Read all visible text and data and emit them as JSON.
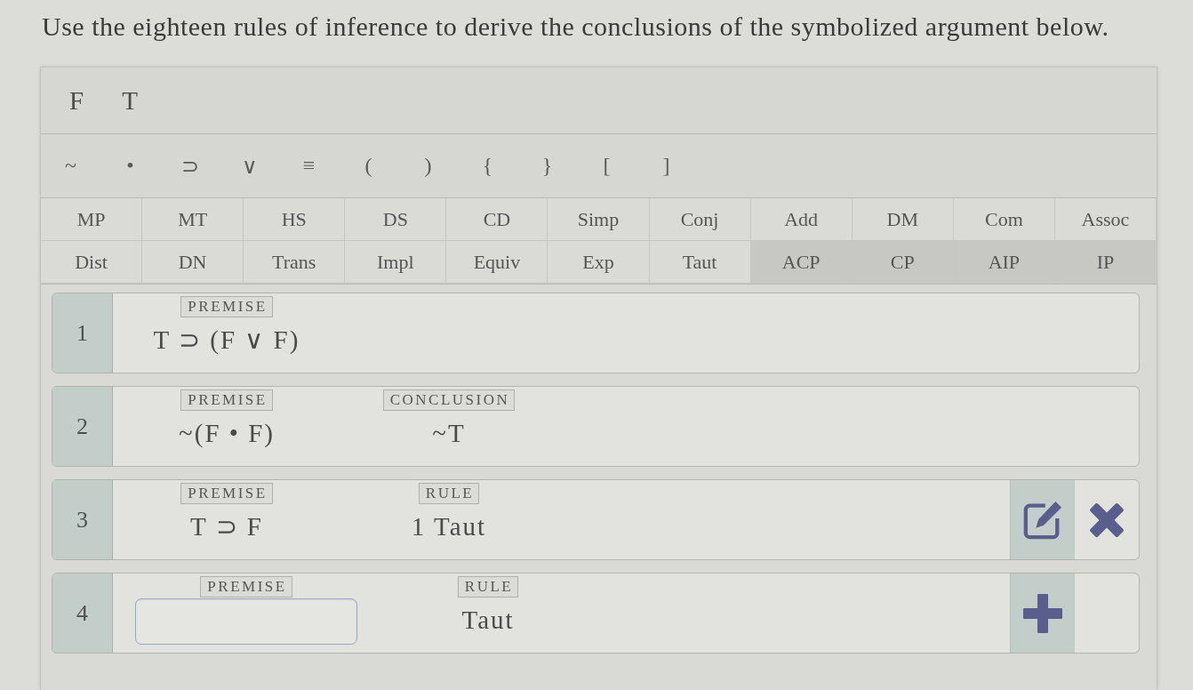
{
  "instruction": "Use the eighteen rules of inference to derive the conclusions of the symbolized argument below.",
  "variables": [
    "F",
    "T"
  ],
  "operators": [
    "~",
    "•",
    "⊃",
    "∨",
    "≡",
    "(",
    ")",
    "{",
    "}",
    "[",
    "]"
  ],
  "rules": [
    [
      {
        "label": "MP",
        "kind": "rule"
      },
      {
        "label": "MT",
        "kind": "rule"
      },
      {
        "label": "HS",
        "kind": "rule"
      },
      {
        "label": "DS",
        "kind": "rule"
      },
      {
        "label": "CD",
        "kind": "rule"
      },
      {
        "label": "Simp",
        "kind": "rule"
      },
      {
        "label": "Conj",
        "kind": "rule"
      },
      {
        "label": "Add",
        "kind": "rule"
      },
      {
        "label": "DM",
        "kind": "rule"
      },
      {
        "label": "Com",
        "kind": "rule"
      },
      {
        "label": "Assoc",
        "kind": "rule"
      }
    ],
    [
      {
        "label": "Dist",
        "kind": "rule"
      },
      {
        "label": "DN",
        "kind": "rule"
      },
      {
        "label": "Trans",
        "kind": "rule"
      },
      {
        "label": "Impl",
        "kind": "rule"
      },
      {
        "label": "Equiv",
        "kind": "rule"
      },
      {
        "label": "Exp",
        "kind": "rule"
      },
      {
        "label": "Taut",
        "kind": "rule"
      },
      {
        "label": "ACP",
        "kind": "proof"
      },
      {
        "label": "CP",
        "kind": "proof"
      },
      {
        "label": "AIP",
        "kind": "proof"
      },
      {
        "label": "IP",
        "kind": "proof"
      }
    ]
  ],
  "lines": [
    {
      "number": "1",
      "columns": [
        {
          "kind": "text",
          "label": "PREMISE",
          "value": "T ⊃ (F ∨ F)"
        }
      ]
    },
    {
      "number": "2",
      "columns": [
        {
          "kind": "text",
          "label": "PREMISE",
          "value": "~(F • F)"
        },
        {
          "kind": "text",
          "label": "CONCLUSION",
          "value": "~T"
        }
      ]
    },
    {
      "number": "3",
      "columns": [
        {
          "kind": "text",
          "label": "PREMISE",
          "value": "T ⊃ F"
        },
        {
          "kind": "text",
          "label": "RULE",
          "value": "1 Taut"
        }
      ],
      "actions": [
        {
          "kind": "edit"
        },
        {
          "kind": "delete"
        }
      ]
    },
    {
      "number": "4",
      "columns": [
        {
          "kind": "input",
          "label": "PREMISE"
        },
        {
          "kind": "text",
          "label": "RULE",
          "value": "Taut"
        }
      ],
      "actions": [
        {
          "kind": "add"
        }
      ]
    }
  ]
}
